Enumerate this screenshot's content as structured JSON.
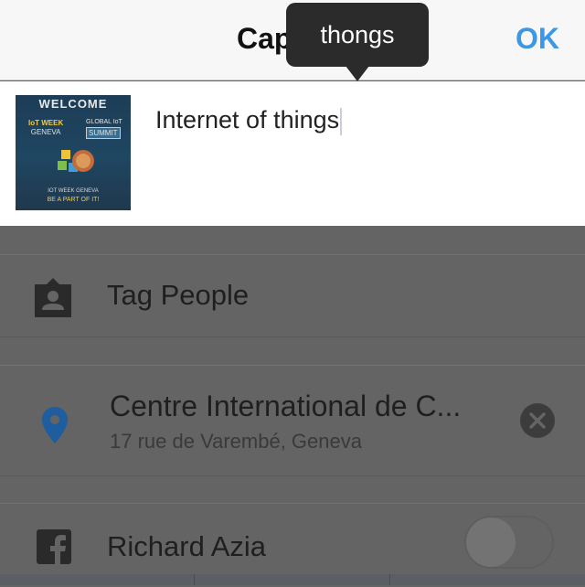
{
  "header": {
    "title": "Cap",
    "ok_label": "OK",
    "accent_color": "#3e97e4"
  },
  "tooltip": {
    "text": "thongs"
  },
  "caption": {
    "text": "Internet of things",
    "thumbnail": {
      "welcome": "WELCOME",
      "iot_line1": "IoT WEEK",
      "iot_line2": "GENEVA",
      "global": "GLOBAL IoT",
      "summit": "SUMMIT",
      "footer1": "IOT WEEK GENEVA",
      "footer2": "BE A PART OF IT!"
    }
  },
  "options": {
    "tag_people": {
      "label": "Tag People",
      "icon": "person-tag-icon"
    },
    "location": {
      "name": "Centre International de C...",
      "address": "17 rue de Varembé, Geneva",
      "icon": "location-pin-icon",
      "pin_color": "#1e5e9e",
      "remove_icon": "close-circle-icon"
    },
    "facebook": {
      "label": "Richard Azia",
      "icon": "facebook-icon",
      "toggle_on": false
    }
  }
}
